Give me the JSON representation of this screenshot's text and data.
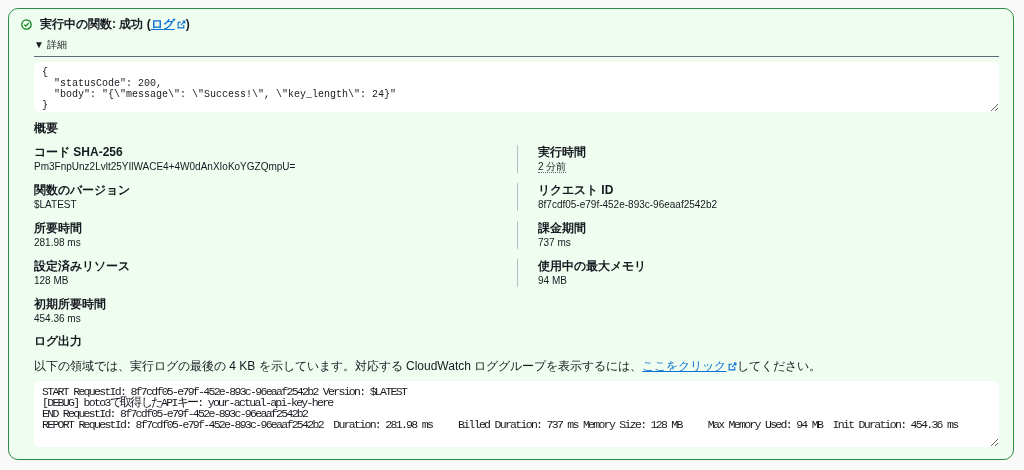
{
  "status": {
    "title": "実行中の関数: 成功 (",
    "link": "ログ",
    "suffix": ")"
  },
  "details": {
    "toggle": "▼",
    "label": "詳細",
    "output": "{\n  \"statusCode\": 200,\n  \"body\": \"{\\\"message\\\": \\\"Success!\\\", \\\"key_length\\\": 24}\"\n}"
  },
  "summary": {
    "title": "概要",
    "left": [
      {
        "label": "コード SHA-256",
        "value": "Pm3FnpUnz2Lvlt25YIlWACE4+4W0dAnXIoKoYGZQmpU=",
        "kind": "text"
      },
      {
        "label": "関数のバージョン",
        "value": "$LATEST",
        "kind": "text"
      },
      {
        "label": "所要時間",
        "value": "281.98 ms",
        "kind": "text"
      },
      {
        "label": "設定済みリソース",
        "value": "128 MB",
        "kind": "text"
      },
      {
        "label": "初期所要時間",
        "value": "454.36 ms",
        "kind": "text"
      }
    ],
    "right": [
      {
        "label": "実行時間",
        "value": "2 分前",
        "kind": "relative_time"
      },
      {
        "label": "リクエスト ID",
        "value": "8f7cdf05-e79f-452e-893c-96eaaf2542b2",
        "kind": "text"
      },
      {
        "label": "課金期間",
        "value": "737 ms",
        "kind": "text"
      },
      {
        "label": "使用中の最大メモリ",
        "value": "94 MB",
        "kind": "text"
      }
    ]
  },
  "log": {
    "title": "ログ出力",
    "intro": "以下の領域では、実行ログの最後の 4 KB を示しています。対応する CloudWatch ロググループを表示するには、",
    "link": "ここをクリック",
    "outro": "してください。",
    "output": "START RequestId: 8f7cdf05-e79f-452e-893c-96eaaf2542b2 Version: $LATEST\n[DEBUG] boto3で取得したAPIキー: your-actual-api-key-here\nEND RequestId: 8f7cdf05-e79f-452e-893c-96eaaf2542b2\nREPORT RequestId: 8f7cdf05-e79f-452e-893c-96eaaf2542b2  Duration: 281.98 ms     Billed Duration: 737 ms Memory Size: 128 MB     Max Memory Used: 94 MB  Init Duration: 454.36 ms"
  }
}
